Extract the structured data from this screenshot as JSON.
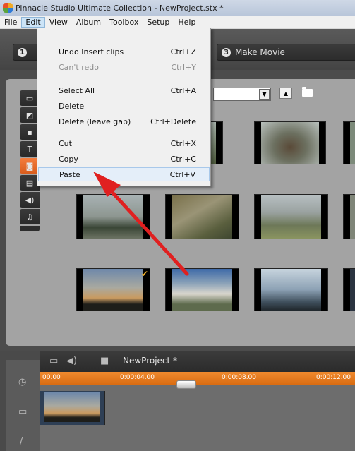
{
  "window": {
    "title": "Pinnacle Studio Ultimate Collection - NewProject.stx *"
  },
  "menubar": {
    "items": [
      "File",
      "Edit",
      "View",
      "Album",
      "Toolbox",
      "Setup",
      "Help"
    ],
    "active": "Edit"
  },
  "steps": {
    "step1_number": "1",
    "step3_number": "3",
    "step3_label": "Make Movie"
  },
  "edit_menu": {
    "items": [
      {
        "label": "Undo  Insert clips",
        "shortcut": "Ctrl+Z",
        "enabled": true
      },
      {
        "label": "Can't redo",
        "shortcut": "Ctrl+Y",
        "enabled": false
      },
      {
        "label": "Select All",
        "shortcut": "Ctrl+A",
        "enabled": true
      },
      {
        "label": "Delete",
        "shortcut": "",
        "enabled": true
      },
      {
        "label": "Delete (leave gap)",
        "shortcut": "Ctrl+Delete",
        "enabled": true
      },
      {
        "label": "Cut",
        "shortcut": "Ctrl+X",
        "enabled": true
      },
      {
        "label": "Copy",
        "shortcut": "Ctrl+C",
        "enabled": true
      },
      {
        "label": "Paste",
        "shortcut": "Ctrl+V",
        "enabled": true,
        "highlighted": true
      }
    ]
  },
  "album": {
    "source_dropdown": "",
    "selected_clip_check": "✔"
  },
  "timeline": {
    "project_name": "NewProject *",
    "ruler": [
      "00.00",
      "0:00:04.00",
      "0:00:08.00",
      "0:00:12.00"
    ]
  },
  "colors": {
    "accent": "#e8741f",
    "annotation_arrow": "#e02020"
  }
}
